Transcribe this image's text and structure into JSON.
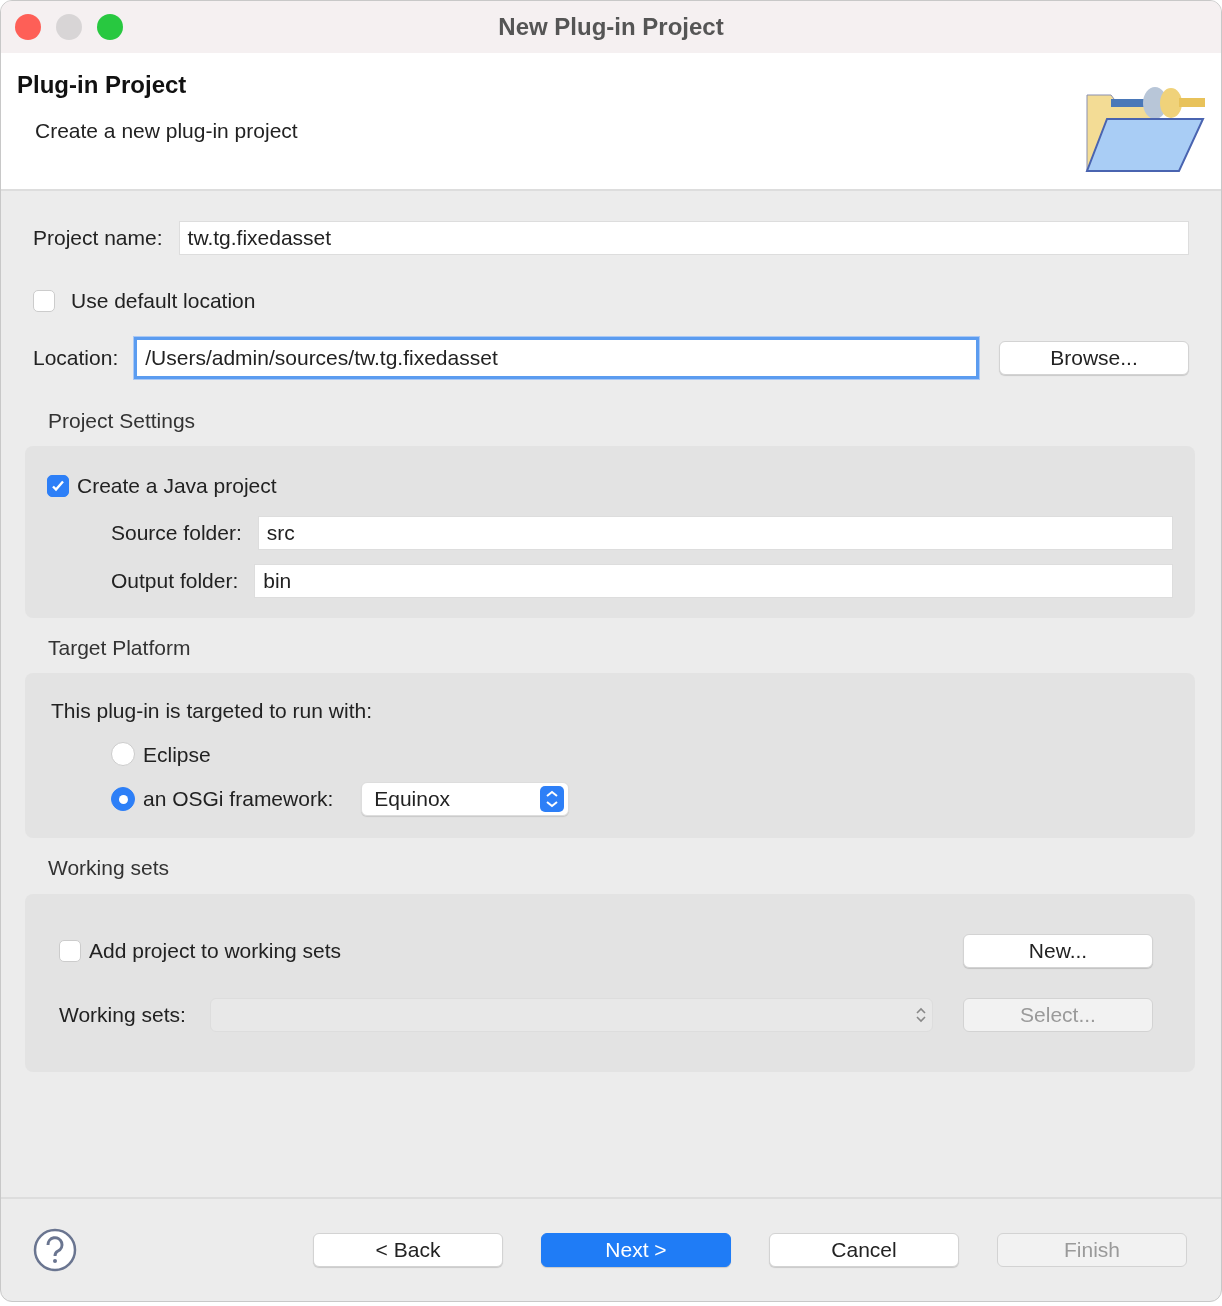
{
  "window": {
    "title": "New Plug-in Project",
    "controls": [
      {
        "kind": "close",
        "disabled": false
      },
      {
        "kind": "minimize",
        "disabled": true
      },
      {
        "kind": "zoom",
        "disabled": false
      }
    ]
  },
  "header": {
    "title": "Plug-in Project",
    "description": "Create a new plug-in project"
  },
  "project_name": {
    "label": "Project name:",
    "value": "tw.tg.fixedasset"
  },
  "use_default_location": {
    "label": "Use default location",
    "checked": false
  },
  "location": {
    "label": "Location:",
    "value": "/Users/admin/sources/tw.tg.fixedasset",
    "focused": true,
    "browse": "Browse..."
  },
  "project_settings": {
    "title": "Project Settings",
    "create_java": {
      "label": "Create a Java project",
      "checked": true
    },
    "fields": [
      {
        "label": "Source folder:",
        "value": "src"
      },
      {
        "label": "Output folder:",
        "value": "bin"
      }
    ]
  },
  "target_platform": {
    "title": "Target Platform",
    "prompt": "This plug-in is targeted to run with:",
    "options": [
      {
        "label": "Eclipse",
        "selected": false,
        "kind": "plain"
      },
      {
        "label": "an OSGi framework:",
        "selected": true,
        "kind": "select",
        "value": "Equinox"
      }
    ]
  },
  "working_sets": {
    "title": "Working sets",
    "add": {
      "label": "Add project to working sets",
      "checked": false
    },
    "new_button": "New...",
    "field": {
      "label": "Working sets:",
      "disabled": true
    },
    "select_button": {
      "label": "Select...",
      "disabled": true
    }
  },
  "buttons": [
    {
      "label": "< Back",
      "kind": "normal",
      "disabled": false
    },
    {
      "label": "Next >",
      "kind": "default",
      "disabled": false
    },
    {
      "label": "Cancel",
      "kind": "normal",
      "disabled": false
    },
    {
      "label": "Finish",
      "kind": "normal",
      "disabled": true
    }
  ]
}
